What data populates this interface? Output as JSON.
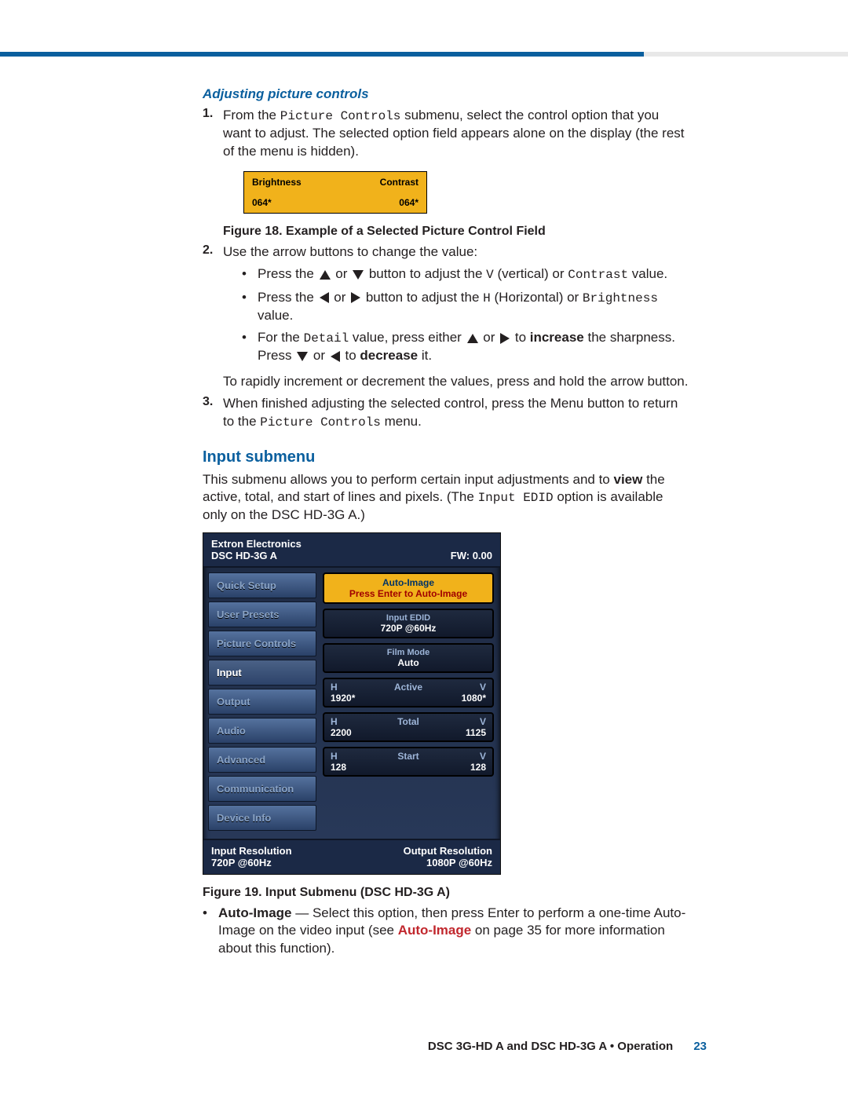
{
  "sectionTitle": "Adjusting picture controls",
  "step1_a": "From the ",
  "step1_code": "Picture Controls",
  "step1_b": " submenu, select the control option that you want to adjust. The selected option field appears alone on the display (the rest of the menu is hidden).",
  "osd_small": {
    "left_label": "Brightness",
    "right_label": "Contrast",
    "left_val": "064*",
    "right_val": "064*"
  },
  "fig18": "Figure 18.   Example of a Selected Picture Control Field",
  "step2_a": "Use the arrow buttons to change the value:",
  "b1_a": "Press the ",
  "b1_b": " or ",
  "b1_c": " button to adjust the ",
  "b1_code1": "V",
  "b1_d": " (vertical) or ",
  "b1_code2": "Contrast",
  "b1_e": " value.",
  "b2_a": "Press the ",
  "b2_b": " or ",
  "b2_c": " button to adjust the ",
  "b2_code1": "H",
  "b2_d": " (Horizontal) or ",
  "b2_code2": "Brightness",
  "b2_e": " value.",
  "b3_a": "For the ",
  "b3_code": "Detail",
  "b3_b": " value, press either ",
  "b3_c": " or ",
  "b3_d": " to ",
  "b3_bold1": "increase",
  "b3_e": " the sharpness. Press ",
  "b3_f": " or ",
  "b3_g": " to ",
  "b3_bold2": "decrease",
  "b3_h": " it.",
  "step2_tail": "To rapidly increment or decrement the values, press and hold the arrow button.",
  "step3_a": "When finished adjusting the selected control, press the Menu button to return to the ",
  "step3_code": "Picture Controls",
  "step3_b": " menu.",
  "head2": "Input submenu",
  "para2_a": "This submenu allows you to perform certain input adjustments and to ",
  "para2_bold": "view",
  "para2_b": " the active, total, and start of lines and pixels. (The ",
  "para2_code": "Input EDID",
  "para2_c": " option is available only on the DSC HD-3G A.)",
  "osd": {
    "brand": "Extron Electronics",
    "model": "DSC HD-3G A",
    "fw": "FW: 0.00",
    "tabs": [
      "Quick Setup",
      "User Presets",
      "Picture Controls",
      "Input",
      "Output",
      "Audio",
      "Advanced",
      "Communication",
      "Device Info"
    ],
    "autoimage_l1": "Auto-Image",
    "autoimage_l2": "Press Enter to Auto-Image",
    "edid_l1": "Input EDID",
    "edid_l2": "720P @60Hz",
    "film_l1": "Film Mode",
    "film_l2": "Auto",
    "row_active": {
      "h": "H",
      "label": "Active",
      "v": "V",
      "hv": "1920*",
      "vv": "1080*"
    },
    "row_total": {
      "h": "H",
      "label": "Total",
      "v": "V",
      "hv": "2200",
      "vv": "1125"
    },
    "row_start": {
      "h": "H",
      "label": "Start",
      "v": "V",
      "hv": "128",
      "vv": "128"
    },
    "footer_inres_l": "Input Resolution",
    "footer_inres_v": "720P @60Hz",
    "footer_outres_l": "Output Resolution",
    "footer_outres_v": "1080P @60Hz"
  },
  "fig19": "Figure 19.   Input Submenu (DSC HD-3G A)",
  "bullet_auto_a": "Auto-Image",
  "bullet_auto_b": " — Select this option, then press Enter to perform a one-time Auto-Image on the video input (see ",
  "bullet_auto_link": "Auto-Image",
  "bullet_auto_c": " on page 35 for more information about this function).",
  "footer_doc": "DSC 3G-HD A and DSC HD-3G A • Operation",
  "footer_page": "23"
}
